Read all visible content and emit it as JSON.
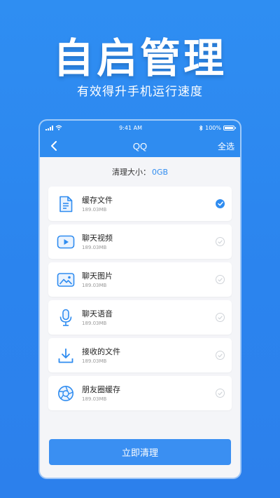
{
  "hero": {
    "title": "自启管理",
    "subtitle": "有效得升手机运行速度"
  },
  "status_bar": {
    "time": "9:41 AM",
    "battery": "100%"
  },
  "nav": {
    "title": "QQ",
    "select_all": "全选"
  },
  "summary": {
    "label": "清理大小：",
    "value": "0GB"
  },
  "items": [
    {
      "name": "缓存文件",
      "size": "189.03MB",
      "icon": "document-icon",
      "checked": true
    },
    {
      "name": "聊天视频",
      "size": "189.03MB",
      "icon": "video-play-icon",
      "checked": false
    },
    {
      "name": "聊天图片",
      "size": "189.03MB",
      "icon": "image-icon",
      "checked": false
    },
    {
      "name": "聊天语音",
      "size": "189.03MB",
      "icon": "microphone-icon",
      "checked": false
    },
    {
      "name": "接收的文件",
      "size": "189.03MB",
      "icon": "download-icon",
      "checked": false
    },
    {
      "name": "朋友圈缓存",
      "size": "189.03MB",
      "icon": "aperture-icon",
      "checked": false
    }
  ],
  "action": {
    "clean_label": "立即清理"
  },
  "colors": {
    "background": "#2c86ef",
    "accent": "#2f8cf0",
    "card": "#ffffff",
    "panel": "#f4f5f8"
  }
}
